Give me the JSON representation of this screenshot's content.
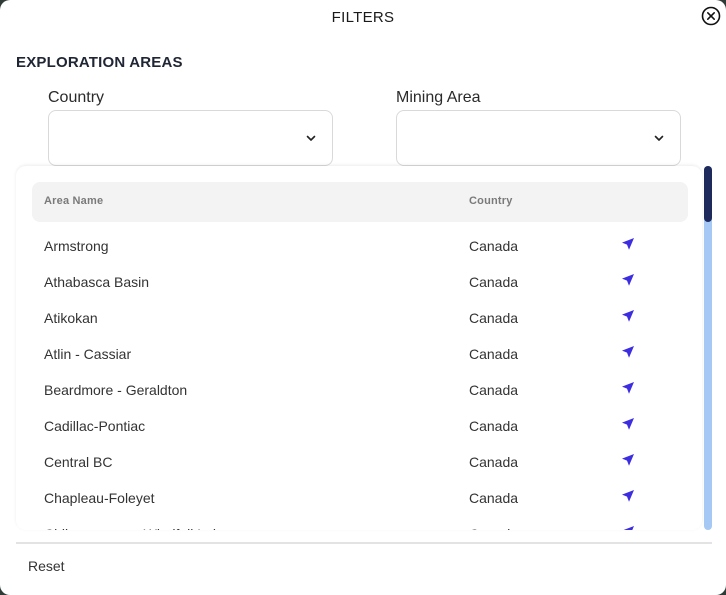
{
  "modal": {
    "title": "FILTERS"
  },
  "section": {
    "title": "EXPLORATION AREAS"
  },
  "filters": {
    "country_label": "Country",
    "country_value": "",
    "mining_area_label": "Mining Area",
    "mining_area_value": ""
  },
  "table": {
    "headers": {
      "name": "Area Name",
      "country": "Country"
    },
    "rows": [
      {
        "name": "Armstrong",
        "country": "Canada"
      },
      {
        "name": "Athabasca Basin",
        "country": "Canada"
      },
      {
        "name": "Atikokan",
        "country": "Canada"
      },
      {
        "name": "Atlin - Cassiar",
        "country": "Canada"
      },
      {
        "name": "Beardmore - Geraldton",
        "country": "Canada"
      },
      {
        "name": "Cadillac-Pontiac",
        "country": "Canada"
      },
      {
        "name": "Central BC",
        "country": "Canada"
      },
      {
        "name": "Chapleau-Foleyet",
        "country": "Canada"
      },
      {
        "name": "Chibougamau - Windfall Lake",
        "country": "Canada"
      }
    ],
    "row_icon": "navigate-arrow-icon"
  },
  "footer": {
    "reset_label": "Reset"
  },
  "colors": {
    "accent": "#3d2de0",
    "scroll_track": "#a6c8f5",
    "scroll_thumb": "#1e2a5c",
    "header_bg": "#f3f3f3"
  }
}
